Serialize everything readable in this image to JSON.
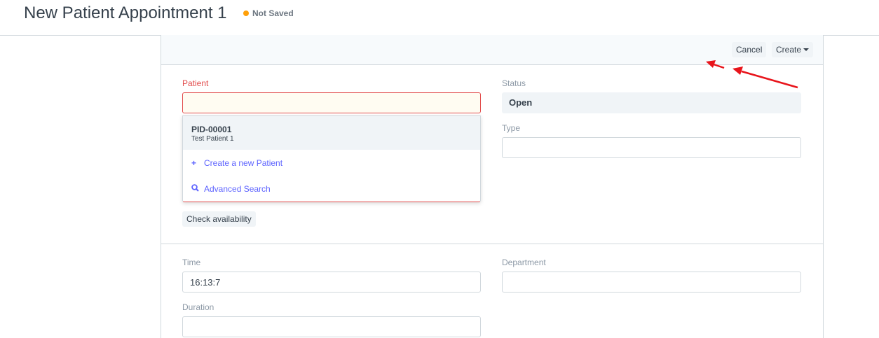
{
  "header": {
    "title": "New Patient Appointment 1",
    "indicator": "Not Saved",
    "indicator_color": "#ffa00a"
  },
  "toolbar": {
    "cancel_label": "Cancel",
    "create_label": "Create"
  },
  "form": {
    "patient_label": "Patient",
    "patient_value": "",
    "status_label": "Status",
    "status_value": "Open",
    "type_label": "Type",
    "type_value": "",
    "check_availability_label": "Check availability",
    "time_label": "Time",
    "time_value": "16:13:7",
    "department_label": "Department",
    "department_value": "",
    "duration_label": "Duration",
    "duration_value": ""
  },
  "dropdown": {
    "result_id": "PID-00001",
    "result_name": "Test Patient 1",
    "create_new_label": "Create a new Patient",
    "create_new_icon": "plus-icon",
    "advanced_search_label": "Advanced Search",
    "advanced_search_icon": "search-icon"
  },
  "colors": {
    "error": "#e24c4c",
    "link": "#5e64ff",
    "annotation_arrow": "#e8141b"
  }
}
